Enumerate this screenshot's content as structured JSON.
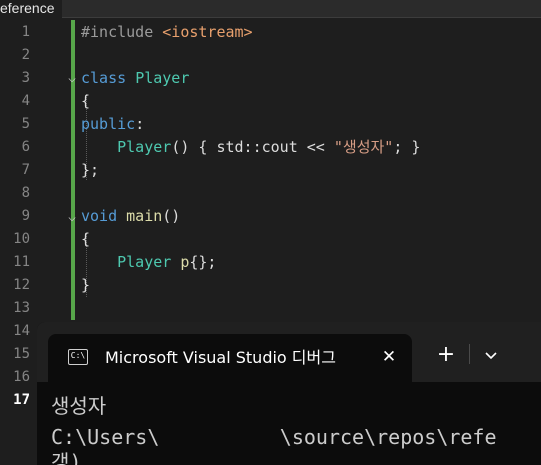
{
  "editor_tab": {
    "label": "eference"
  },
  "line_numbers": [
    "1",
    "2",
    "3",
    "4",
    "5",
    "6",
    "7",
    "8",
    "9",
    "10",
    "11",
    "12",
    "13",
    "14",
    "15",
    "16",
    "17"
  ],
  "current_line": "17",
  "code": {
    "l1": {
      "directive": "#include",
      "header": "<iostream>"
    },
    "l3": {
      "kw": "class",
      "name": "Player"
    },
    "l4": {
      "brace": "{"
    },
    "l5": {
      "access": "public",
      "colon": ":"
    },
    "l6": {
      "ctor": "Player",
      "rest1": "() { std::cout << ",
      "str": "\"생성자\"",
      "rest2": "; }"
    },
    "l7": {
      "close": "};"
    },
    "l9": {
      "kw": "void",
      "fn": "main",
      "parens": "()"
    },
    "l10": {
      "brace": "{"
    },
    "l11": {
      "type": "Player",
      "var": "p",
      "init": "{};"
    },
    "l12": {
      "brace": "}"
    }
  },
  "console": {
    "app_icon_text": "C:\\",
    "tab_title": "Microsoft Visual Studio 디버그",
    "close_symbol": "✕",
    "new_tab_symbol": "+",
    "output_line1": "생성자",
    "output_line2": "C:\\Users\\          \\source\\repos\\refe",
    "output_line3": "갱)"
  }
}
